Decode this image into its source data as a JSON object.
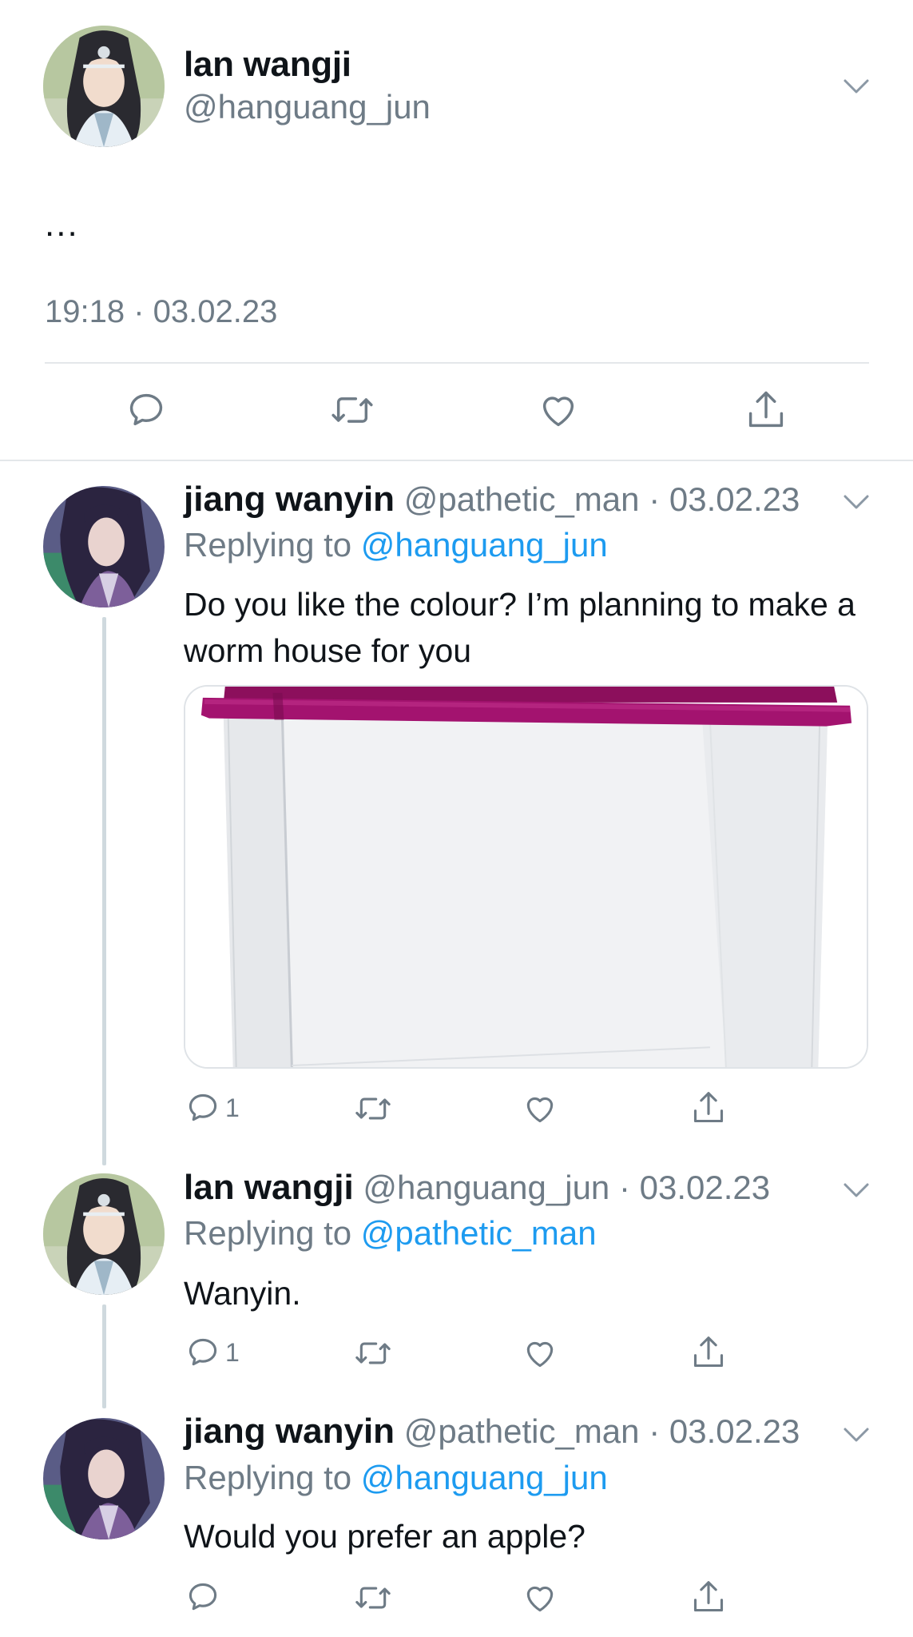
{
  "main_tweet": {
    "name": "lan wangji",
    "handle": "@hanguang_jun",
    "text": "...",
    "timestamp": "19:18 · 03.02.23"
  },
  "replies": [
    {
      "name": "jiang wanyin",
      "handle": "@pathetic_man",
      "date": "03.02.23",
      "replying_label": "Replying to",
      "replying_to": "@hanguang_jun",
      "text": "Do you like the colour? I’m planning to make a worm house for you",
      "reply_count": "1"
    },
    {
      "name": "lan wangji",
      "handle": "@hanguang_jun",
      "date": "03.02.23",
      "replying_label": "Replying to",
      "replying_to": "@pathetic_man",
      "text": "Wanyin.",
      "reply_count": "1"
    },
    {
      "name": "jiang wanyin",
      "handle": "@pathetic_man",
      "date": "03.02.23",
      "replying_label": "Replying to",
      "replying_to": "@hanguang_jun",
      "text": "Would you prefer an apple?",
      "reply_count": ""
    }
  ],
  "separator": "·",
  "colors": {
    "link_blue": "#1d9bf0",
    "secondary_grey": "#6e7b86",
    "lid_magenta": "#a3136f"
  },
  "icons": [
    "chevron-down-icon",
    "reply-icon",
    "retweet-icon",
    "like-icon",
    "share-icon"
  ]
}
